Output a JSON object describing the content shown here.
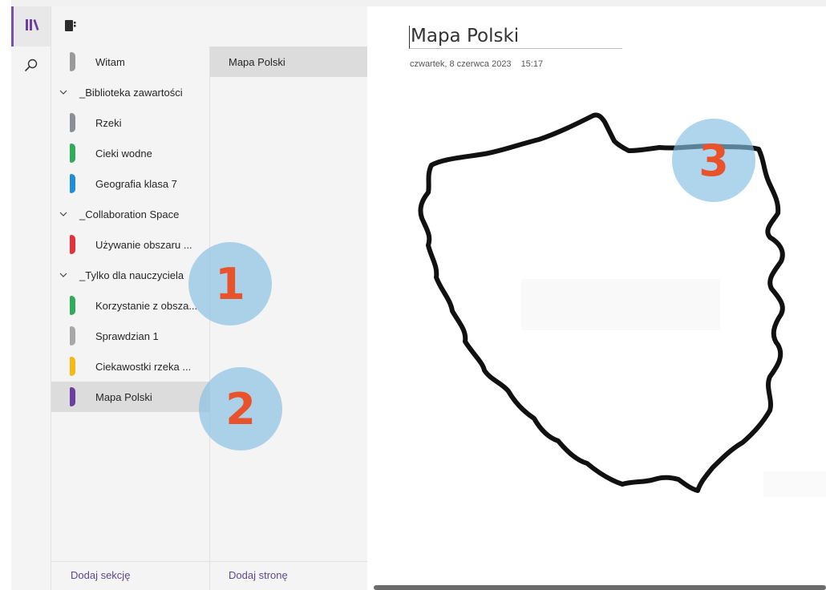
{
  "sidebar": {
    "sections": [
      {
        "label": "Witam",
        "color": "#9a9a9a"
      },
      {
        "label": "Rzeki",
        "color": "#8a8f94"
      },
      {
        "label": "Cieki wodne",
        "color": "#2fab5a"
      },
      {
        "label": "Geografia klasa 7",
        "color": "#1e8fd6"
      },
      {
        "label": "Używanie obszaru ...",
        "color": "#e53238"
      },
      {
        "label": "Korzystanie z obsza...",
        "color": "#2fab5a"
      },
      {
        "label": "Sprawdzian 1",
        "color": "#a8a8a8"
      },
      {
        "label": "Ciekawostki rzeka ...",
        "color": "#f5b916"
      },
      {
        "label": "Mapa Polski",
        "color": "#6a3fa0"
      }
    ],
    "groups": [
      {
        "label": "_Biblioteka zawartości"
      },
      {
        "label": "_Collaboration Space"
      },
      {
        "label": "_Tylko dla nauczyciela"
      }
    ],
    "add_section": "Dodaj sekcję"
  },
  "pages": {
    "items": [
      {
        "label": "Mapa Polski"
      }
    ],
    "add_page": "Dodaj stronę"
  },
  "page": {
    "title": "Mapa Polski",
    "date": "czwartek, 8 czerwca 2023",
    "time": "15:17"
  },
  "callouts": [
    "1",
    "2",
    "3"
  ],
  "colors": {
    "accent": "#7b4fa6",
    "callout_fill": "#84bee2",
    "callout_text": "#e8532b",
    "link": "#5b4a8b"
  }
}
